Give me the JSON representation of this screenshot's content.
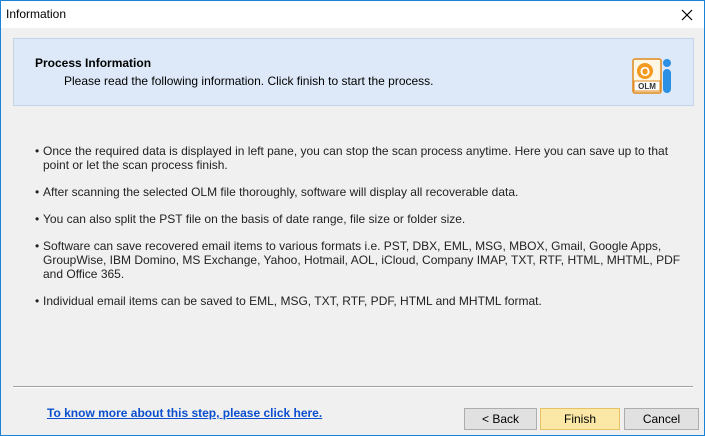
{
  "window": {
    "title": "Information"
  },
  "header": {
    "title": "Process Information",
    "subtitle": "Please read the following information. Click finish to start the process.",
    "icon_text": "OLM",
    "icon_letter": "O"
  },
  "bullets": [
    {
      "dot": "•",
      "text": "Once the required data is displayed in left pane, you can stop the scan process anytime. Here you can save up to that point or let the scan process finish."
    },
    {
      "dot": "•",
      "text": "After scanning the selected OLM file thoroughly, software will display all recoverable data."
    },
    {
      "dot": "•",
      "text": "You can also split the PST file on the basis of date range, file size or folder size."
    },
    {
      "dot": "•",
      "text": "Software can save recovered email items to various formats i.e. PST, DBX, EML, MSG, MBOX, Gmail, Google Apps, GroupWise, IBM Domino, MS Exchange, Yahoo, Hotmail, AOL, iCloud, Company IMAP, TXT, RTF, HTML, MHTML, PDF and Office 365."
    },
    {
      "dot": "•",
      "text": "Individual email items can be saved to EML, MSG, TXT, RTF, PDF, HTML and MHTML format."
    }
  ],
  "footer": {
    "help_link": "To know more about this step, please click here.",
    "back_label": "< Back",
    "finish_label": "Finish",
    "cancel_label": "Cancel"
  },
  "colors": {
    "header_bg": "#dde9f8",
    "link": "#0b4fcf",
    "finish_bg": "#fbe8a6",
    "window_border": "#1883d7"
  },
  "icons": {
    "close": "close-icon",
    "olm": "olm-info-icon"
  }
}
